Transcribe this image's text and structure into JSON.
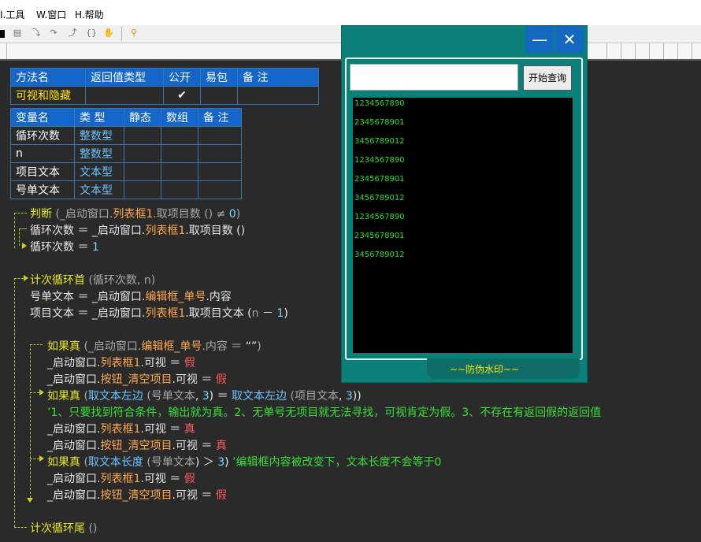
{
  "menu": {
    "tools": "I.工具",
    "window": "W.窗口",
    "help": "H.帮助"
  },
  "toolbar": {
    "icons": [
      "save-icon",
      "doc-icon",
      "step-into-icon",
      "step-over-icon",
      "step-out-icon",
      "hand-icon",
      "find-icon"
    ]
  },
  "method_table": {
    "headers": [
      "方法名",
      "返回值类型",
      "公开",
      "易包",
      "备 注"
    ],
    "row": {
      "name": "可视和隐藏",
      "return_type": "",
      "public_mark": "✔",
      "easy_pkg": "",
      "note": ""
    }
  },
  "var_table": {
    "headers": [
      "变量名",
      "类 型",
      "静态",
      "数组",
      "备 注"
    ],
    "rows": [
      {
        "name": "循环次数",
        "type": "整数型"
      },
      {
        "name": "n",
        "type": "整数型"
      },
      {
        "name": "项目文本",
        "type": "文本型"
      },
      {
        "name": "号单文本",
        "type": "文本型"
      }
    ]
  },
  "code": {
    "l1": {
      "kw": "判断",
      "p1": " (_启动窗口.",
      "obj": "列表框1",
      "p2": ".取项目数 () ≠ ",
      "num": "0",
      "p3": ")"
    },
    "l2": {
      "a": "循环次数",
      "b": " ＝ _启动窗口.",
      "obj": "列表框1",
      "c": ".取项目数 ()"
    },
    "l3": {
      "a": "循环次数",
      "b": " ＝ ",
      "num": "1"
    },
    "l4": {
      "kw": "计次循环首",
      "a": " (",
      "var": "循环次数",
      "b": ", ",
      "var2": "n",
      "c": ")"
    },
    "l5": {
      "a": "号单文本 ＝ _启动窗口.",
      "obj": "编辑框_单号",
      "b": ".内容"
    },
    "l6": {
      "a": "项目文本 ＝ _启动窗口.",
      "obj": "列表框1",
      "b": ".取项目文本 (",
      "var": "n",
      "c": " － ",
      "num": "1",
      "d": ")"
    },
    "l7": {
      "kw": "如果真",
      "a": " (_启动窗口.",
      "obj": "编辑框_单号",
      "b": ".内容 ＝ ",
      "str": "“”",
      "c": ")"
    },
    "l8": {
      "a": "_启动窗口.",
      "obj": "列表框1",
      "b": ".可视 ＝ ",
      "val": "假"
    },
    "l9": {
      "a": "_启动窗口.",
      "obj": "按钮_清空项目",
      "b": ".可视 ＝ ",
      "val": "假"
    },
    "l10": {
      "kw": "如果真",
      "a": " (",
      "fn": "取文本左边",
      "b": " (",
      "var": "号单文本",
      "c": ", ",
      "num": "3",
      "d": ") ＝ ",
      "fn2": "取文本左边",
      "e": " (",
      "var2": "项目文本",
      "f": ", ",
      "num2": "3",
      "g": "))"
    },
    "l11": {
      "comment": "’1、只要找到符合条件，输出就为真。2、无单号无项目就无法寻找，可视肯定为假。3、不存在有返回假的返回值"
    },
    "l12": {
      "a": "_启动窗口.",
      "obj": "列表框1",
      "b": ".可视 ＝ ",
      "val": "真"
    },
    "l13": {
      "a": "_启动窗口.",
      "obj": "按钮_清空项目",
      "b": ".可视 ＝ ",
      "val": "真"
    },
    "l14": {
      "kw": "如果真",
      "a": " (",
      "fn": "取文本长度",
      "b": " (",
      "var": "号单文本",
      "c": ") ＞ ",
      "num": "3",
      "d": ")",
      "comment": "   ’编辑框内容被改变下，文本长度不会等于0"
    },
    "l15": {
      "a": "_启动窗口.",
      "obj": "列表框1",
      "b": ".可视 ＝ ",
      "val": "假"
    },
    "l16": {
      "a": "_启动窗口.",
      "obj": "按钮_清空项目",
      "b": ".可视 ＝ ",
      "val": "假"
    },
    "l17": {
      "kw": "计次循环尾",
      "a": " ()"
    }
  },
  "window": {
    "minimize": "—",
    "close": "✕",
    "input_value": "",
    "query_button": "开始查询",
    "list": [
      "1234567890",
      "2345678901",
      "3456789012",
      "1234567890",
      "2345678901",
      "3456789012",
      "1234567890",
      "2345678901",
      "3456789012"
    ],
    "footer": "~~防伪水印~~"
  },
  "colors": {
    "background": "#2a2a2a",
    "header_blue": "#1467c8",
    "window_teal": "#0a8078",
    "list_green": "#28e028",
    "watermark_yellow": "#ffe400"
  }
}
